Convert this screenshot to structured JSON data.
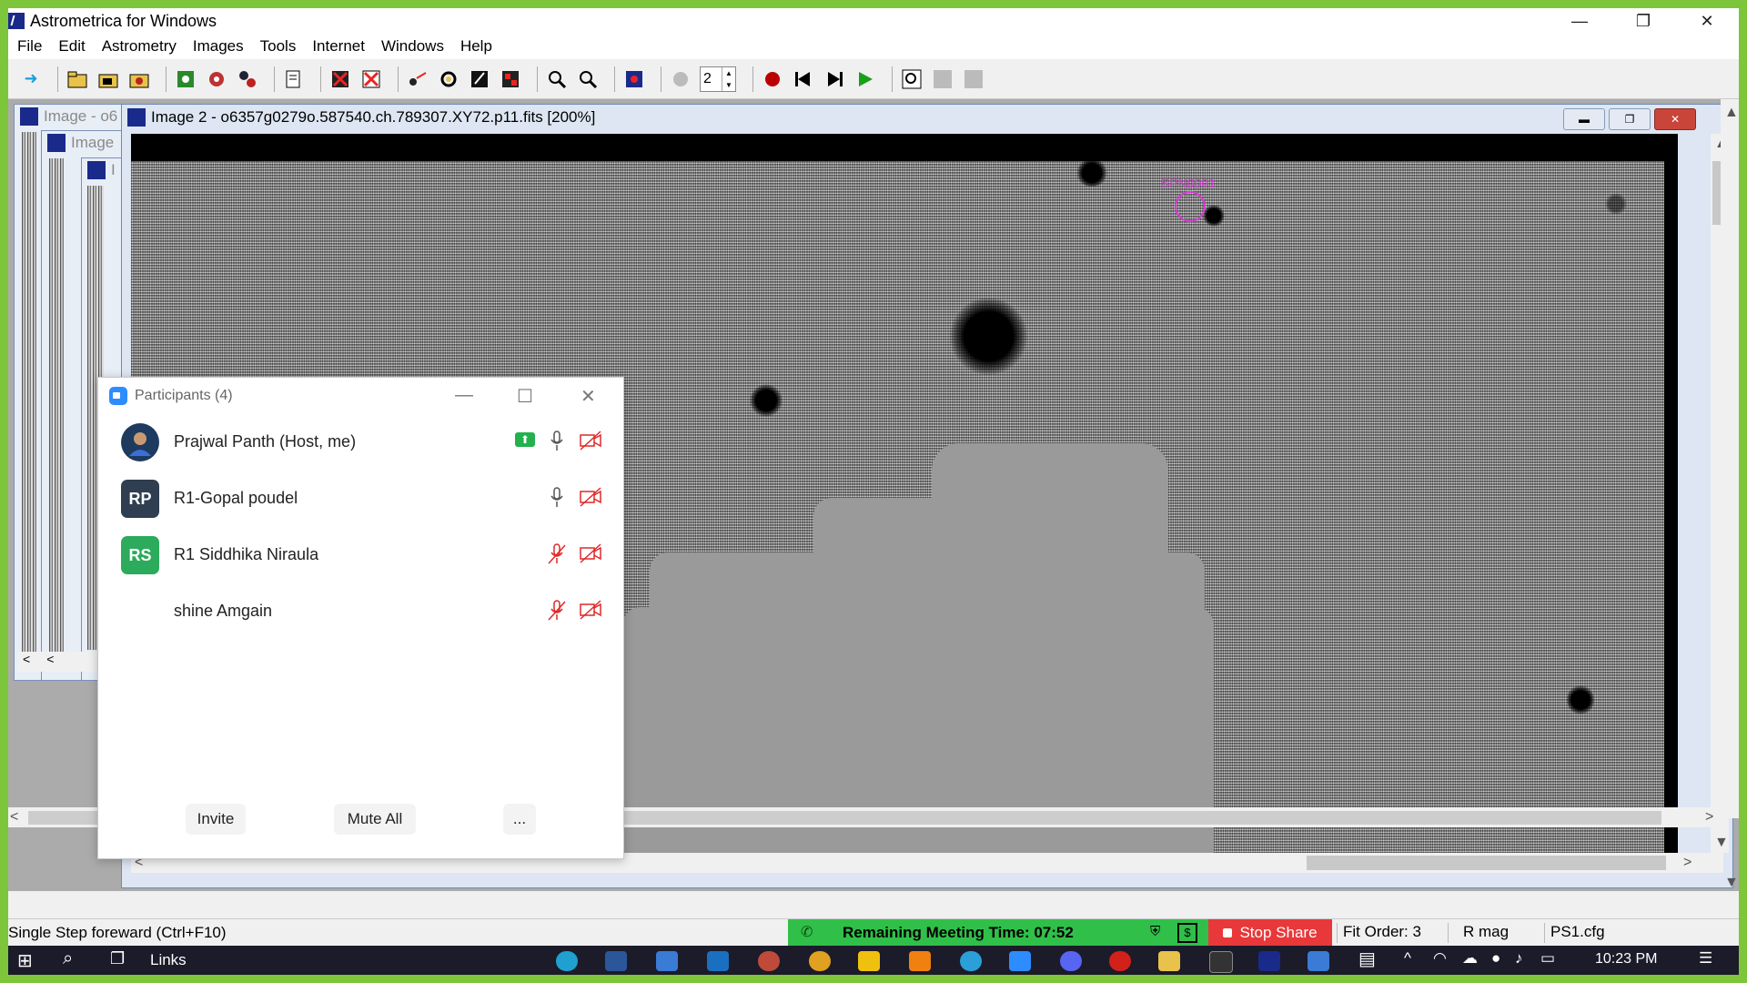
{
  "window": {
    "title": "Astrometrica for Windows",
    "minimize": "—",
    "restore": "❐",
    "close": "✕"
  },
  "menu": [
    "File",
    "Edit",
    "Astrometry",
    "Images",
    "Tools",
    "Internet",
    "Windows",
    "Help"
  ],
  "toolbar": {
    "spin_value": "2",
    "icons": [
      "arrow-icon",
      "open-folder-icon",
      "open-images-icon",
      "load-catalog-icon",
      "data-reduction-icon",
      "settings-icon",
      "star-icon",
      "stack-icon",
      "report-icon",
      "delete-icon",
      "close-all-icon",
      "moving-object-icon",
      "circle-icon",
      "edit-icon",
      "blink-icon",
      "zoom-in-icon",
      "zoom-out-icon",
      "view-icon",
      "disabled-icon",
      "record-icon",
      "step-back-icon",
      "step-forward-icon",
      "play-icon",
      "magnifier-icon"
    ]
  },
  "background_windows": [
    {
      "title": "Image - o6"
    },
    {
      "title": "Image"
    },
    {
      "title": "I"
    }
  ],
  "image_window": {
    "title": "Image 2 - o6357g0279o.587540.ch.789307.XY72.p11.fits [200%]",
    "marker_label": "SPN0001"
  },
  "participants": {
    "title": "Participants (4)",
    "list": [
      {
        "name": "Prajwal Panth (Host, me)",
        "initials": "",
        "color": "#1e3a5f",
        "sharing": true,
        "mic_muted": false,
        "video_off": true
      },
      {
        "name": "R1-Gopal poudel",
        "initials": "RP",
        "color": "#2f3e50",
        "sharing": false,
        "mic_muted": false,
        "video_off": true
      },
      {
        "name": "R1 Siddhika Niraula",
        "initials": "RS",
        "color": "#2bab5b",
        "sharing": false,
        "mic_muted": true,
        "video_off": true
      },
      {
        "name": "shine Amgain",
        "initials": "",
        "color": "#ffffff",
        "sharing": false,
        "mic_muted": true,
        "video_off": true
      }
    ],
    "buttons": {
      "invite": "Invite",
      "mute_all": "Mute All",
      "more": "..."
    }
  },
  "statusbar": {
    "text": "Single Step foreward (Ctrl+F10)",
    "meeting": "Remaining Meeting Time: 07:52",
    "stop_share": "Stop Share",
    "fit_order": "Fit Order: 3",
    "mag": "R mag",
    "config": "PS1.cfg"
  },
  "taskbar": {
    "links": "Links",
    "time": "10:23 PM"
  }
}
